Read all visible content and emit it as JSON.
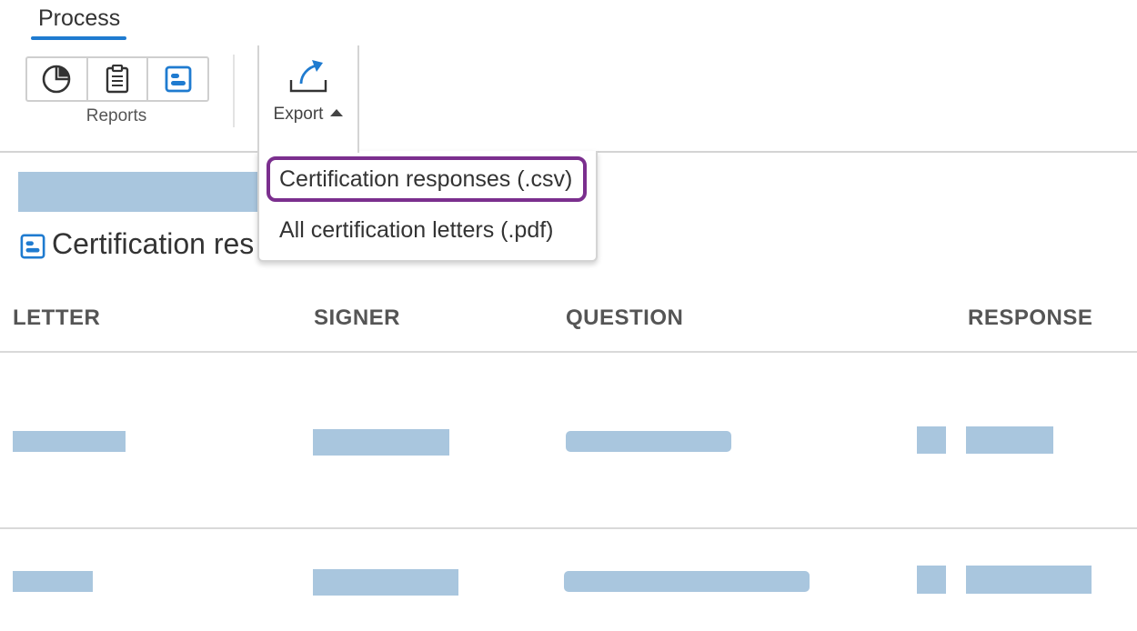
{
  "tab": {
    "label": "Process"
  },
  "reports": {
    "label": "Reports",
    "buttons": [
      {
        "icon": "pie-chart-icon"
      },
      {
        "icon": "clipboard-icon"
      },
      {
        "icon": "certification-icon"
      }
    ]
  },
  "export": {
    "label": "Export",
    "icon": "export-upload-icon",
    "menu": [
      "Certification responses (.csv)",
      "All certification letters (.pdf)"
    ]
  },
  "page": {
    "title": "Certification res"
  },
  "table": {
    "columns": [
      "LETTER",
      "SIGNER",
      "QUESTION",
      "RESPONSE"
    ]
  },
  "colors": {
    "accent": "#1f7bd0",
    "highlight": "#7b2f8e",
    "skeleton": "#a9c6de"
  }
}
